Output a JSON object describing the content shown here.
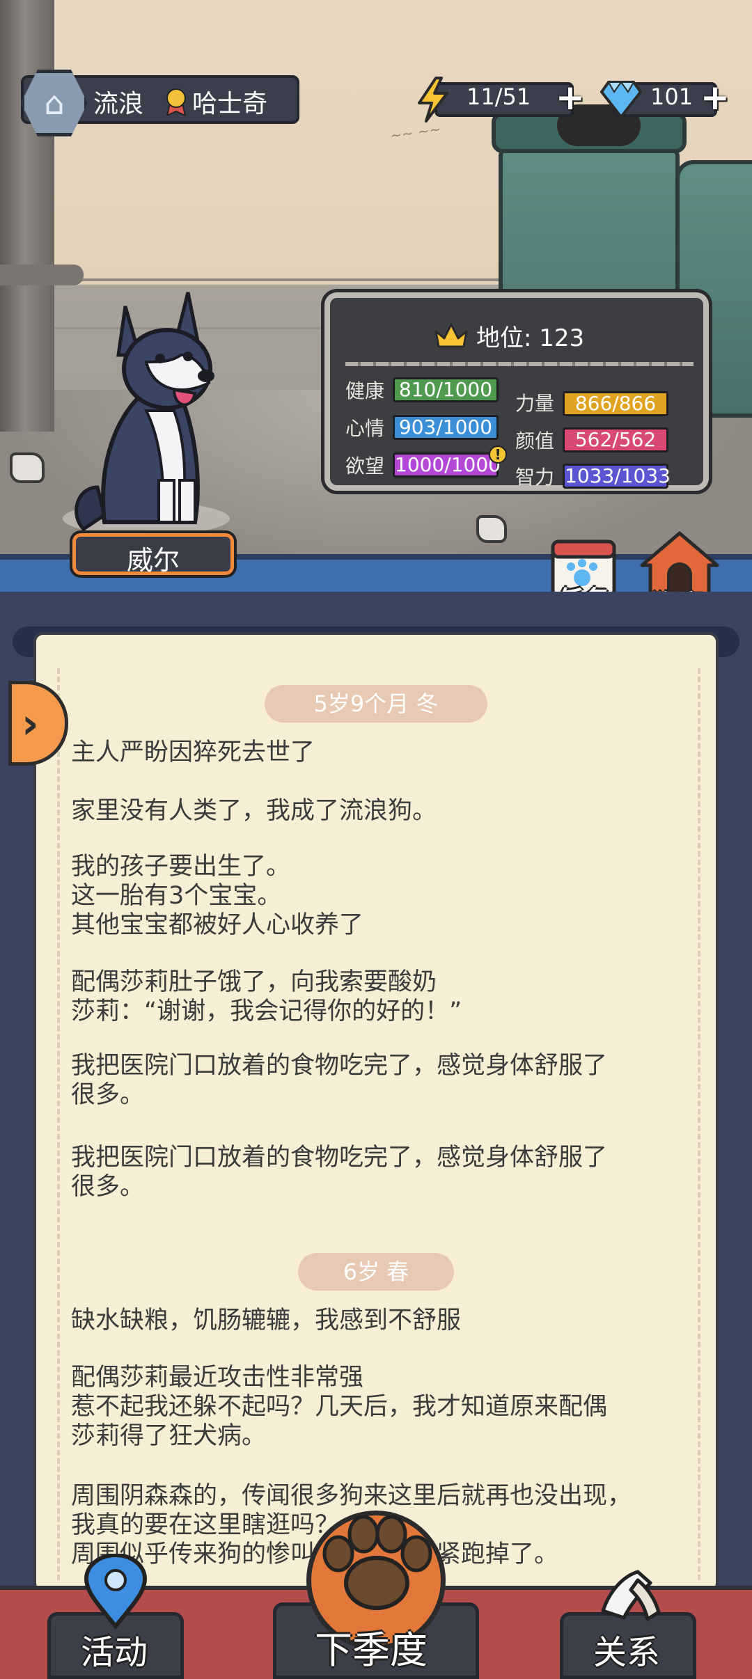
{
  "hud": {
    "status_label": "流浪",
    "breed_label": "哈士奇",
    "energy": "11/51",
    "gems": "101"
  },
  "board": {
    "title": "地位: 123",
    "stats": [
      {
        "label": "健康",
        "value": "810/1000",
        "color": "#4f9a4f"
      },
      {
        "label": "力量",
        "value": "866/866",
        "color": "#e0a321"
      },
      {
        "label": "心情",
        "value": "903/1000",
        "color": "#3a8fd6"
      },
      {
        "label": "颜值",
        "value": "562/562",
        "color": "#d84a73"
      },
      {
        "label": "欲望",
        "value": "1000/1000",
        "color": "#b348d6"
      },
      {
        "label": "智力",
        "value": "1033/1033",
        "color": "#5a55d1"
      }
    ]
  },
  "dog": {
    "name": "威尔"
  },
  "shortcuts": {
    "tasks": "任务",
    "kennel": "狗窝"
  },
  "journal": {
    "sections": [
      {
        "age": "5岁9个月 冬",
        "entries": [
          "主人严盼因猝死去世了",
          "家里没有人类了，我成了流浪狗。",
          "我的孩子要出生了。\n这一胎有3个宝宝。\n其他宝宝都被好人心收养了",
          "配偶莎莉肚子饿了，向我索要酸奶\n莎莉：“谢谢，我会记得你的好的！”",
          "我把医院门口放着的食物吃完了，感觉身体舒服了\n很多。",
          "我把医院门口放着的食物吃完了，感觉身体舒服了\n很多。"
        ]
      },
      {
        "age": "6岁 春",
        "entries": [
          "缺水缺粮，饥肠辘辘，我感到不舒服",
          "配偶莎莉最近攻击性非常强\n惹不起我还躲不起吗？几天后，我才知道原来配偶\n莎莉得了狂犬病。",
          "周围阴森森的，传闻很多狗来这里后就再也没出现，\n我真的要在这里瞎逛吗？\n周围似乎传来狗的惨叫，吓得我赶紧跑掉了。"
        ]
      }
    ]
  },
  "bottom": {
    "activity": "活动",
    "next_season": "下季度",
    "relations": "关系"
  },
  "icons": [
    "lightning-icon",
    "diamond-icon",
    "crown-icon",
    "medal-icon",
    "paw-icon",
    "map-pin-icon",
    "handshake-icon",
    "calendar-icon",
    "doghouse-icon",
    "chevron-right-icon"
  ]
}
